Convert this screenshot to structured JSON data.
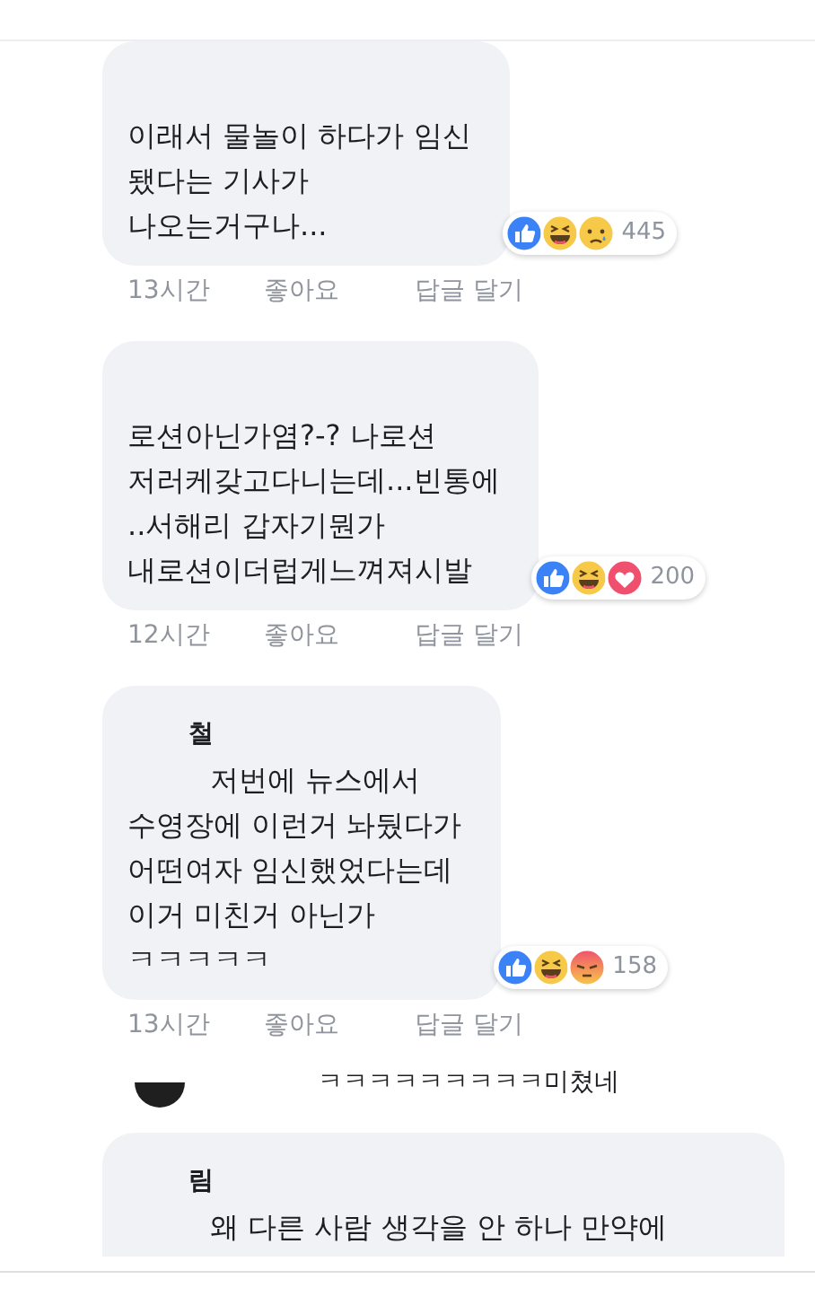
{
  "comments": [
    {
      "kind": "comment",
      "lines": [
        "이래서 물놀이 하다가 임신",
        "됐다는 기사가",
        "나오는거구나..."
      ],
      "reactions": [
        {
          "kind": "like"
        },
        {
          "kind": "haha"
        },
        {
          "kind": "sad"
        }
      ],
      "reaction_count": "445",
      "time": "13시간",
      "like_label": "좋아요",
      "reply_label": "답글 달기"
    },
    {
      "kind": "comment",
      "lines": [
        "로션아닌가염?-? 나로션",
        "저러케갖고다니는데...빈통에",
        "..서해리 갑자기뭔가",
        "내로션이더럽게느껴져시발"
      ],
      "reactions": [
        {
          "kind": "like"
        },
        {
          "kind": "haha"
        },
        {
          "kind": "love"
        }
      ],
      "reaction_count": "200",
      "time": "12시간",
      "like_label": "좋아요",
      "reply_label": "답글 달기"
    },
    {
      "kind": "comment",
      "name": "철",
      "lines": [
        "저번에 뉴스에서",
        "수영장에 이런거 놔뒀다가",
        "어떤여자 임신했었다는데",
        "이거 미친거 아닌가",
        "ㅋㅋㅋㅋㅋ"
      ],
      "reactions": [
        {
          "kind": "like"
        },
        {
          "kind": "haha"
        },
        {
          "kind": "angry"
        }
      ],
      "reaction_count": "158",
      "time": "13시간",
      "like_label": "좋아요",
      "reply_label": "답글 달기"
    },
    {
      "kind": "reply",
      "text": "ㅋㅋㅋㅋㅋㅋㅋㅋㅋ미쳤네"
    },
    {
      "kind": "cut",
      "name": "림",
      "lines": [
        "왜 다른 사람 생각을 안 하나 만약에"
      ]
    }
  ]
}
